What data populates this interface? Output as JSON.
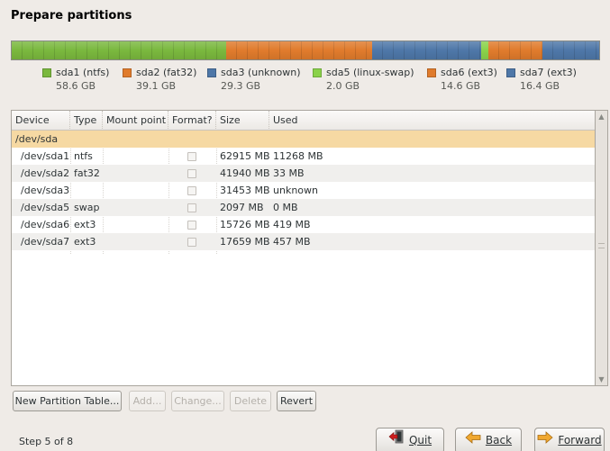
{
  "page": {
    "title": "Prepare partitions"
  },
  "colors": {
    "ntfs": "#7cbb3c",
    "fat32": "#e47e2b",
    "unknown": "#4f78a9",
    "linux_swap": "#89d34b",
    "ext3": "#e48a35",
    "selected_row": "#f6d9a3"
  },
  "partition_bar": [
    {
      "name": "sda1",
      "share": 0.365,
      "color": "#7ab83e"
    },
    {
      "name": "sda2",
      "share": 0.248,
      "color": "#e07b2c"
    },
    {
      "name": "sda3",
      "share": 0.186,
      "color": "#4e77a8"
    },
    {
      "name": "sda5",
      "share": 0.012,
      "color": "#8ad24a"
    },
    {
      "name": "sda6",
      "share": 0.093,
      "color": "#e07b2c"
    },
    {
      "name": "sda7",
      "share": 0.096,
      "color": "#4e77a8"
    }
  ],
  "legend": [
    {
      "label": "sda1 (ntfs)",
      "size": "58.6 GB",
      "color": "#7ab83e"
    },
    {
      "label": "sda2 (fat32)",
      "size": "39.1 GB",
      "color": "#e07b2c"
    },
    {
      "label": "sda3 (unknown)",
      "size": "29.3 GB",
      "color": "#4e77a8"
    },
    {
      "label": "sda5 (linux-swap)",
      "size": "2.0 GB",
      "color": "#8ad24a"
    },
    {
      "label": "sda6 (ext3)",
      "size": "14.6 GB",
      "color": "#e07b2c"
    },
    {
      "label": "sda7 (ext3)",
      "size": "16.4 GB",
      "color": "#4e77a8"
    }
  ],
  "table": {
    "columns": [
      "Device",
      "Type",
      "Mount point",
      "Format?",
      "Size",
      "Used"
    ],
    "rows": [
      {
        "device": "/dev/sda",
        "type": "",
        "mount": "",
        "format": "",
        "size": "",
        "used": ""
      },
      {
        "device": "/dev/sda1",
        "type": "ntfs",
        "mount": "",
        "format": "unchecked",
        "size": "62915 MB",
        "used": "11268 MB"
      },
      {
        "device": "/dev/sda2",
        "type": "fat32",
        "mount": "",
        "format": "unchecked",
        "size": "41940 MB",
        "used": "33 MB"
      },
      {
        "device": "/dev/sda3",
        "type": "",
        "mount": "",
        "format": "unchecked",
        "size": "31453 MB",
        "used": "unknown"
      },
      {
        "device": "/dev/sda5",
        "type": "swap",
        "mount": "",
        "format": "unchecked",
        "size": "2097 MB",
        "used": "0 MB"
      },
      {
        "device": "/dev/sda6",
        "type": "ext3",
        "mount": "",
        "format": "unchecked",
        "size": "15726 MB",
        "used": "419 MB"
      },
      {
        "device": "/dev/sda7",
        "type": "ext3",
        "mount": "",
        "format": "unchecked",
        "size": "17659 MB",
        "used": "457 MB"
      }
    ]
  },
  "actions": {
    "new_partition_table": "New Partition Table...",
    "add": "Add...",
    "change": "Change...",
    "delete": "Delete",
    "revert": "Revert"
  },
  "footer": {
    "step": "Step 5 of 8",
    "quit": "Quit",
    "back": "Back",
    "forward": "Forward"
  }
}
